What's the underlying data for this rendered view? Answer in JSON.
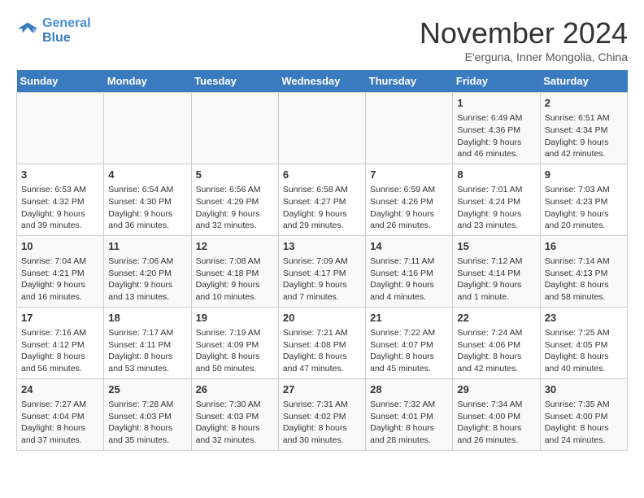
{
  "header": {
    "logo_line1": "General",
    "logo_line2": "Blue",
    "month_title": "November 2024",
    "subtitle": "E'erguna, Inner Mongolia, China"
  },
  "days_of_week": [
    "Sunday",
    "Monday",
    "Tuesday",
    "Wednesday",
    "Thursday",
    "Friday",
    "Saturday"
  ],
  "weeks": [
    [
      {
        "day": "",
        "info": ""
      },
      {
        "day": "",
        "info": ""
      },
      {
        "day": "",
        "info": ""
      },
      {
        "day": "",
        "info": ""
      },
      {
        "day": "",
        "info": ""
      },
      {
        "day": "1",
        "info": "Sunrise: 6:49 AM\nSunset: 4:36 PM\nDaylight: 9 hours and 46 minutes."
      },
      {
        "day": "2",
        "info": "Sunrise: 6:51 AM\nSunset: 4:34 PM\nDaylight: 9 hours and 42 minutes."
      }
    ],
    [
      {
        "day": "3",
        "info": "Sunrise: 6:53 AM\nSunset: 4:32 PM\nDaylight: 9 hours and 39 minutes."
      },
      {
        "day": "4",
        "info": "Sunrise: 6:54 AM\nSunset: 4:30 PM\nDaylight: 9 hours and 36 minutes."
      },
      {
        "day": "5",
        "info": "Sunrise: 6:56 AM\nSunset: 4:29 PM\nDaylight: 9 hours and 32 minutes."
      },
      {
        "day": "6",
        "info": "Sunrise: 6:58 AM\nSunset: 4:27 PM\nDaylight: 9 hours and 29 minutes."
      },
      {
        "day": "7",
        "info": "Sunrise: 6:59 AM\nSunset: 4:26 PM\nDaylight: 9 hours and 26 minutes."
      },
      {
        "day": "8",
        "info": "Sunrise: 7:01 AM\nSunset: 4:24 PM\nDaylight: 9 hours and 23 minutes."
      },
      {
        "day": "9",
        "info": "Sunrise: 7:03 AM\nSunset: 4:23 PM\nDaylight: 9 hours and 20 minutes."
      }
    ],
    [
      {
        "day": "10",
        "info": "Sunrise: 7:04 AM\nSunset: 4:21 PM\nDaylight: 9 hours and 16 minutes."
      },
      {
        "day": "11",
        "info": "Sunrise: 7:06 AM\nSunset: 4:20 PM\nDaylight: 9 hours and 13 minutes."
      },
      {
        "day": "12",
        "info": "Sunrise: 7:08 AM\nSunset: 4:18 PM\nDaylight: 9 hours and 10 minutes."
      },
      {
        "day": "13",
        "info": "Sunrise: 7:09 AM\nSunset: 4:17 PM\nDaylight: 9 hours and 7 minutes."
      },
      {
        "day": "14",
        "info": "Sunrise: 7:11 AM\nSunset: 4:16 PM\nDaylight: 9 hours and 4 minutes."
      },
      {
        "day": "15",
        "info": "Sunrise: 7:12 AM\nSunset: 4:14 PM\nDaylight: 9 hours and 1 minute."
      },
      {
        "day": "16",
        "info": "Sunrise: 7:14 AM\nSunset: 4:13 PM\nDaylight: 8 hours and 58 minutes."
      }
    ],
    [
      {
        "day": "17",
        "info": "Sunrise: 7:16 AM\nSunset: 4:12 PM\nDaylight: 8 hours and 56 minutes."
      },
      {
        "day": "18",
        "info": "Sunrise: 7:17 AM\nSunset: 4:11 PM\nDaylight: 8 hours and 53 minutes."
      },
      {
        "day": "19",
        "info": "Sunrise: 7:19 AM\nSunset: 4:09 PM\nDaylight: 8 hours and 50 minutes."
      },
      {
        "day": "20",
        "info": "Sunrise: 7:21 AM\nSunset: 4:08 PM\nDaylight: 8 hours and 47 minutes."
      },
      {
        "day": "21",
        "info": "Sunrise: 7:22 AM\nSunset: 4:07 PM\nDaylight: 8 hours and 45 minutes."
      },
      {
        "day": "22",
        "info": "Sunrise: 7:24 AM\nSunset: 4:06 PM\nDaylight: 8 hours and 42 minutes."
      },
      {
        "day": "23",
        "info": "Sunrise: 7:25 AM\nSunset: 4:05 PM\nDaylight: 8 hours and 40 minutes."
      }
    ],
    [
      {
        "day": "24",
        "info": "Sunrise: 7:27 AM\nSunset: 4:04 PM\nDaylight: 8 hours and 37 minutes."
      },
      {
        "day": "25",
        "info": "Sunrise: 7:28 AM\nSunset: 4:03 PM\nDaylight: 8 hours and 35 minutes."
      },
      {
        "day": "26",
        "info": "Sunrise: 7:30 AM\nSunset: 4:03 PM\nDaylight: 8 hours and 32 minutes."
      },
      {
        "day": "27",
        "info": "Sunrise: 7:31 AM\nSunset: 4:02 PM\nDaylight: 8 hours and 30 minutes."
      },
      {
        "day": "28",
        "info": "Sunrise: 7:32 AM\nSunset: 4:01 PM\nDaylight: 8 hours and 28 minutes."
      },
      {
        "day": "29",
        "info": "Sunrise: 7:34 AM\nSunset: 4:00 PM\nDaylight: 8 hours and 26 minutes."
      },
      {
        "day": "30",
        "info": "Sunrise: 7:35 AM\nSunset: 4:00 PM\nDaylight: 8 hours and 24 minutes."
      }
    ]
  ]
}
